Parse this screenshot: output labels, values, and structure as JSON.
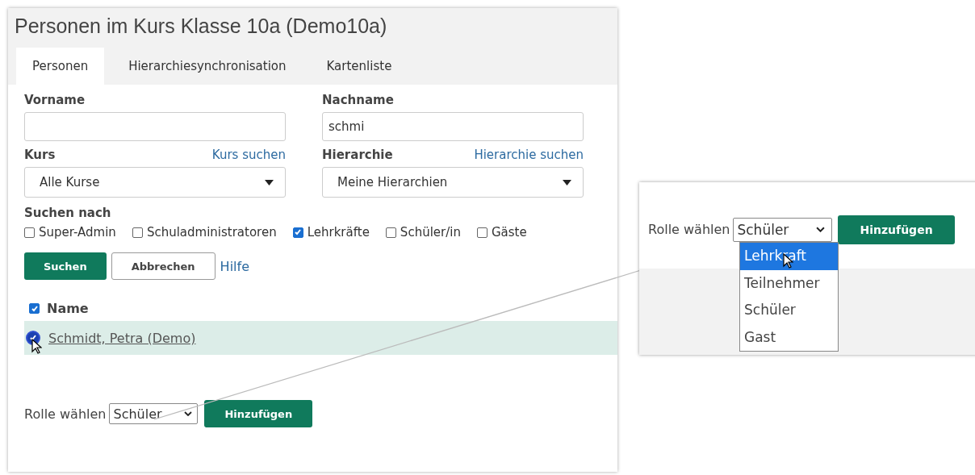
{
  "page": {
    "title": "Personen im Kurs Klasse 10a (Demo10a)"
  },
  "tabs": [
    {
      "label": "Personen",
      "selected": true
    },
    {
      "label": "Hierarchiesynchronisation",
      "selected": false
    },
    {
      "label": "Kartenliste",
      "selected": false
    }
  ],
  "form": {
    "first_name": {
      "label": "Vorname"
    },
    "last_name": {
      "label": "Nachname",
      "value": "schmi"
    },
    "course": {
      "label": "Kurs",
      "link": "Kurs suchen",
      "value": "Alle Kurse"
    },
    "hierarchy": {
      "label": "Hierarchie",
      "link": "Hierarchie suchen",
      "value": "Meine Hierarchien"
    }
  },
  "search_for": {
    "label": "Suchen nach",
    "options": [
      {
        "label": "Super-Admin",
        "checked": false
      },
      {
        "label": "Schuladministratoren",
        "checked": false
      },
      {
        "label": "Lehrkräfte",
        "checked": true
      },
      {
        "label": "Schüler/in",
        "checked": false
      },
      {
        "label": "Gäste",
        "checked": false
      }
    ]
  },
  "buttons": [
    {
      "label": "Suchen",
      "kind": "primary"
    },
    {
      "label": "Abbrechen",
      "kind": "secondary"
    },
    {
      "label": "Hilfe",
      "kind": "link"
    }
  ],
  "results": {
    "header": {
      "label": "Name",
      "checked": true
    },
    "rows": [
      {
        "name": "Schmidt, Petra (Demo)",
        "checked": true,
        "selected": true
      }
    ]
  },
  "role": {
    "label": "Rolle wählen",
    "value": "Schüler",
    "button": "Hinzufügen"
  },
  "zoom_inset": {
    "label": "Rolle wählen",
    "value": "Schüler",
    "button": "Hinzufügen",
    "options": [
      {
        "label": "Lehrkraft",
        "highlighted": true
      },
      {
        "label": "Teilnehmer",
        "highlighted": false
      },
      {
        "label": "Schüler",
        "highlighted": false
      },
      {
        "label": "Gast",
        "highlighted": false
      }
    ]
  }
}
